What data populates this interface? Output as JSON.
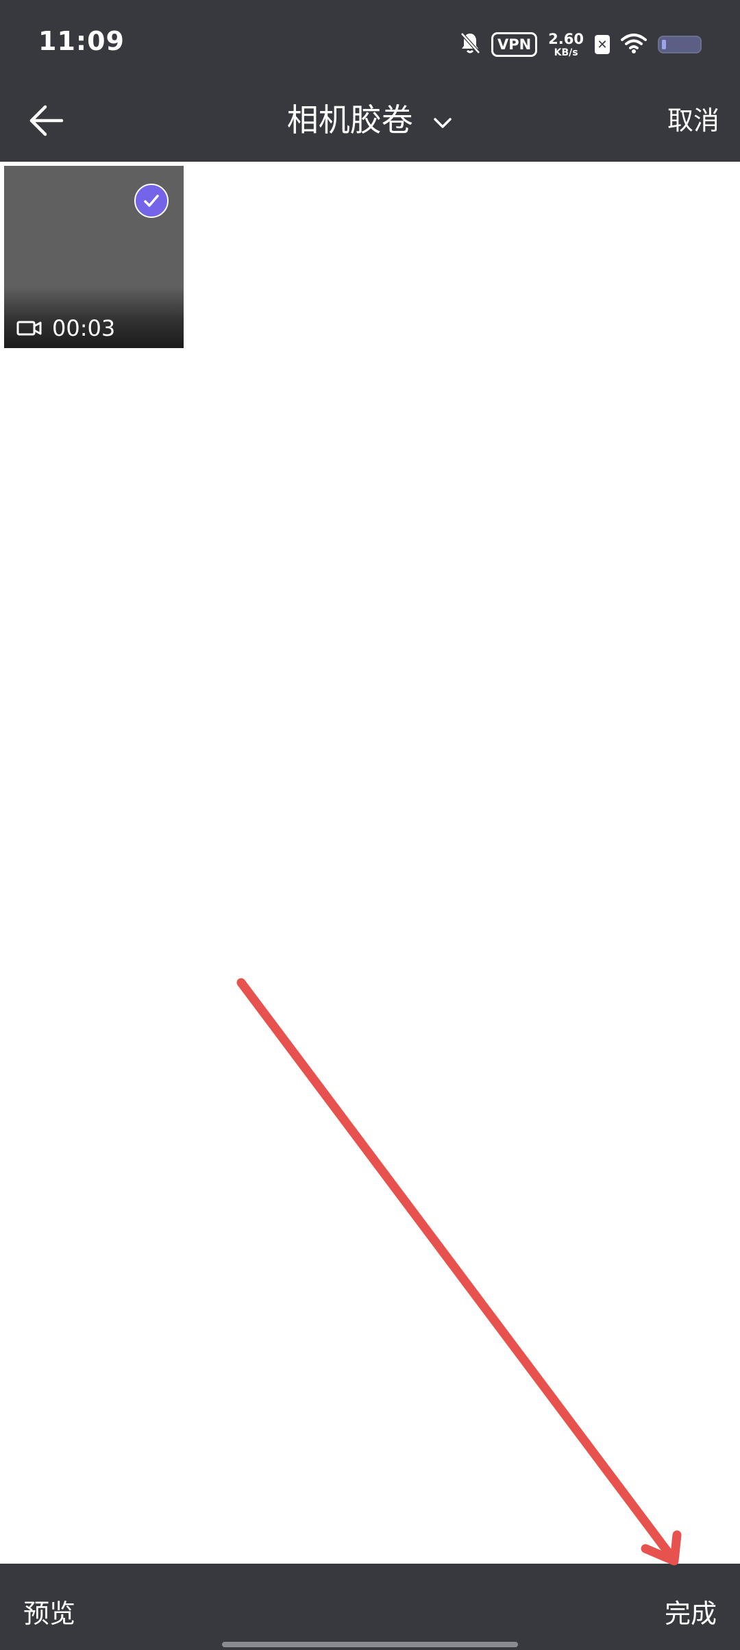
{
  "status_bar": {
    "time": "11:09",
    "vpn_label": "VPN",
    "net_speed_value": "2.60",
    "net_speed_unit": "KB/s",
    "icons": [
      "bell-off-icon",
      "vpn-icon",
      "sim-x-icon",
      "wifi-icon",
      "battery-icon"
    ]
  },
  "header": {
    "title": "相机胶卷",
    "cancel_label": "取消",
    "icons": [
      "back-arrow-icon",
      "chevron-down-icon"
    ]
  },
  "media_items": [
    {
      "type": "video",
      "duration": "00:03",
      "selected": true,
      "icons": [
        "video-camera-icon",
        "checkmark-icon"
      ]
    }
  ],
  "footer": {
    "preview_label": "预览",
    "done_label": "完成"
  },
  "colors": {
    "bar_background": "#38393e",
    "selected_accent": "#7364e8",
    "annotation_arrow": "#e8524e"
  }
}
